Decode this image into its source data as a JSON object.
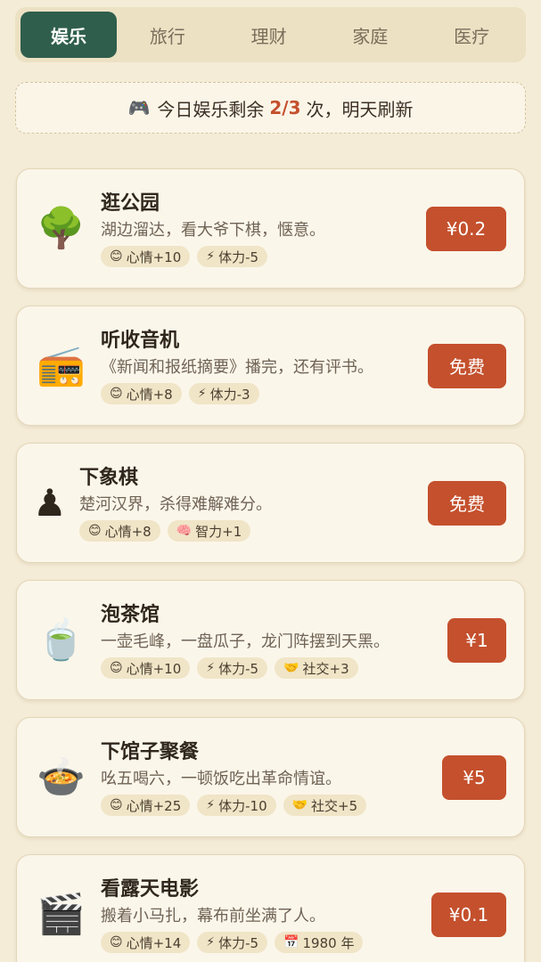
{
  "tabs": [
    {
      "label": "娱乐",
      "active": true
    },
    {
      "label": "旅行",
      "active": false
    },
    {
      "label": "理财",
      "active": false
    },
    {
      "label": "家庭",
      "active": false
    },
    {
      "label": "医疗",
      "active": false
    }
  ],
  "notice": {
    "icon": "🎮",
    "prefix": "今日娱乐剩余",
    "count": "2/3",
    "suffix": "次，明天刷新"
  },
  "items": [
    {
      "icon": "🌳",
      "icon_name": "tree-icon",
      "title": "逛公园",
      "desc": "湖边溜达，看大爷下棋，惬意。",
      "tags": [
        {
          "icon": "😊",
          "text": "心情+10"
        },
        {
          "icon": "⚡",
          "text": "体力-5"
        }
      ],
      "price": "¥0.2"
    },
    {
      "icon": "📻",
      "icon_name": "radio-icon",
      "title": "听收音机",
      "desc": "《新闻和报纸摘要》播完，还有评书。",
      "tags": [
        {
          "icon": "😊",
          "text": "心情+8"
        },
        {
          "icon": "⚡",
          "text": "体力-3"
        }
      ],
      "price": "免费"
    },
    {
      "icon": "♟",
      "icon_name": "chess-pawn-icon",
      "title": "下象棋",
      "desc": "楚河汉界，杀得难解难分。",
      "tags": [
        {
          "icon": "😊",
          "text": "心情+8"
        },
        {
          "icon": "🧠",
          "text": "智力+1"
        }
      ],
      "price": "免费"
    },
    {
      "icon": "🍵",
      "icon_name": "tea-cup-icon",
      "title": "泡茶馆",
      "desc": "一壶毛峰，一盘瓜子，龙门阵摆到天黑。",
      "tags": [
        {
          "icon": "😊",
          "text": "心情+10"
        },
        {
          "icon": "⚡",
          "text": "体力-5"
        },
        {
          "icon": "🤝",
          "text": "社交+3"
        }
      ],
      "price": "¥1"
    },
    {
      "icon": "🍲",
      "icon_name": "hot-pot-icon",
      "title": "下馆子聚餐",
      "desc": "吆五喝六，一顿饭吃出革命情谊。",
      "tags": [
        {
          "icon": "😊",
          "text": "心情+25"
        },
        {
          "icon": "⚡",
          "text": "体力-10"
        },
        {
          "icon": "🤝",
          "text": "社交+5"
        }
      ],
      "price": "¥5"
    },
    {
      "icon": "🎬",
      "icon_name": "clapperboard-icon",
      "title": "看露天电影",
      "desc": "搬着小马扎，幕布前坐满了人。",
      "tags": [
        {
          "icon": "😊",
          "text": "心情+14"
        },
        {
          "icon": "⚡",
          "text": "体力-5"
        },
        {
          "icon": "📅",
          "text": "1980 年"
        }
      ],
      "price": "¥0.1"
    }
  ]
}
